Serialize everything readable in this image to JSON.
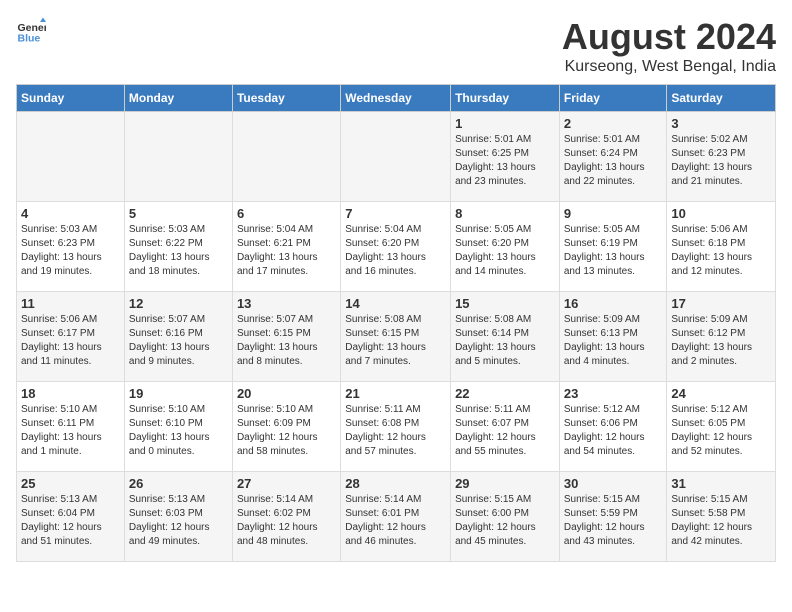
{
  "logo": {
    "general": "General",
    "blue": "Blue"
  },
  "header": {
    "title": "August 2024",
    "subtitle": "Kurseong, West Bengal, India"
  },
  "days_of_week": [
    "Sunday",
    "Monday",
    "Tuesday",
    "Wednesday",
    "Thursday",
    "Friday",
    "Saturday"
  ],
  "weeks": [
    [
      {
        "day": "",
        "info": ""
      },
      {
        "day": "",
        "info": ""
      },
      {
        "day": "",
        "info": ""
      },
      {
        "day": "",
        "info": ""
      },
      {
        "day": "1",
        "info": "Sunrise: 5:01 AM\nSunset: 6:25 PM\nDaylight: 13 hours\nand 23 minutes."
      },
      {
        "day": "2",
        "info": "Sunrise: 5:01 AM\nSunset: 6:24 PM\nDaylight: 13 hours\nand 22 minutes."
      },
      {
        "day": "3",
        "info": "Sunrise: 5:02 AM\nSunset: 6:23 PM\nDaylight: 13 hours\nand 21 minutes."
      }
    ],
    [
      {
        "day": "4",
        "info": "Sunrise: 5:03 AM\nSunset: 6:23 PM\nDaylight: 13 hours\nand 19 minutes."
      },
      {
        "day": "5",
        "info": "Sunrise: 5:03 AM\nSunset: 6:22 PM\nDaylight: 13 hours\nand 18 minutes."
      },
      {
        "day": "6",
        "info": "Sunrise: 5:04 AM\nSunset: 6:21 PM\nDaylight: 13 hours\nand 17 minutes."
      },
      {
        "day": "7",
        "info": "Sunrise: 5:04 AM\nSunset: 6:20 PM\nDaylight: 13 hours\nand 16 minutes."
      },
      {
        "day": "8",
        "info": "Sunrise: 5:05 AM\nSunset: 6:20 PM\nDaylight: 13 hours\nand 14 minutes."
      },
      {
        "day": "9",
        "info": "Sunrise: 5:05 AM\nSunset: 6:19 PM\nDaylight: 13 hours\nand 13 minutes."
      },
      {
        "day": "10",
        "info": "Sunrise: 5:06 AM\nSunset: 6:18 PM\nDaylight: 13 hours\nand 12 minutes."
      }
    ],
    [
      {
        "day": "11",
        "info": "Sunrise: 5:06 AM\nSunset: 6:17 PM\nDaylight: 13 hours\nand 11 minutes."
      },
      {
        "day": "12",
        "info": "Sunrise: 5:07 AM\nSunset: 6:16 PM\nDaylight: 13 hours\nand 9 minutes."
      },
      {
        "day": "13",
        "info": "Sunrise: 5:07 AM\nSunset: 6:15 PM\nDaylight: 13 hours\nand 8 minutes."
      },
      {
        "day": "14",
        "info": "Sunrise: 5:08 AM\nSunset: 6:15 PM\nDaylight: 13 hours\nand 7 minutes."
      },
      {
        "day": "15",
        "info": "Sunrise: 5:08 AM\nSunset: 6:14 PM\nDaylight: 13 hours\nand 5 minutes."
      },
      {
        "day": "16",
        "info": "Sunrise: 5:09 AM\nSunset: 6:13 PM\nDaylight: 13 hours\nand 4 minutes."
      },
      {
        "day": "17",
        "info": "Sunrise: 5:09 AM\nSunset: 6:12 PM\nDaylight: 13 hours\nand 2 minutes."
      }
    ],
    [
      {
        "day": "18",
        "info": "Sunrise: 5:10 AM\nSunset: 6:11 PM\nDaylight: 13 hours\nand 1 minute."
      },
      {
        "day": "19",
        "info": "Sunrise: 5:10 AM\nSunset: 6:10 PM\nDaylight: 13 hours\nand 0 minutes."
      },
      {
        "day": "20",
        "info": "Sunrise: 5:10 AM\nSunset: 6:09 PM\nDaylight: 12 hours\nand 58 minutes."
      },
      {
        "day": "21",
        "info": "Sunrise: 5:11 AM\nSunset: 6:08 PM\nDaylight: 12 hours\nand 57 minutes."
      },
      {
        "day": "22",
        "info": "Sunrise: 5:11 AM\nSunset: 6:07 PM\nDaylight: 12 hours\nand 55 minutes."
      },
      {
        "day": "23",
        "info": "Sunrise: 5:12 AM\nSunset: 6:06 PM\nDaylight: 12 hours\nand 54 minutes."
      },
      {
        "day": "24",
        "info": "Sunrise: 5:12 AM\nSunset: 6:05 PM\nDaylight: 12 hours\nand 52 minutes."
      }
    ],
    [
      {
        "day": "25",
        "info": "Sunrise: 5:13 AM\nSunset: 6:04 PM\nDaylight: 12 hours\nand 51 minutes."
      },
      {
        "day": "26",
        "info": "Sunrise: 5:13 AM\nSunset: 6:03 PM\nDaylight: 12 hours\nand 49 minutes."
      },
      {
        "day": "27",
        "info": "Sunrise: 5:14 AM\nSunset: 6:02 PM\nDaylight: 12 hours\nand 48 minutes."
      },
      {
        "day": "28",
        "info": "Sunrise: 5:14 AM\nSunset: 6:01 PM\nDaylight: 12 hours\nand 46 minutes."
      },
      {
        "day": "29",
        "info": "Sunrise: 5:15 AM\nSunset: 6:00 PM\nDaylight: 12 hours\nand 45 minutes."
      },
      {
        "day": "30",
        "info": "Sunrise: 5:15 AM\nSunset: 5:59 PM\nDaylight: 12 hours\nand 43 minutes."
      },
      {
        "day": "31",
        "info": "Sunrise: 5:15 AM\nSunset: 5:58 PM\nDaylight: 12 hours\nand 42 minutes."
      }
    ]
  ]
}
